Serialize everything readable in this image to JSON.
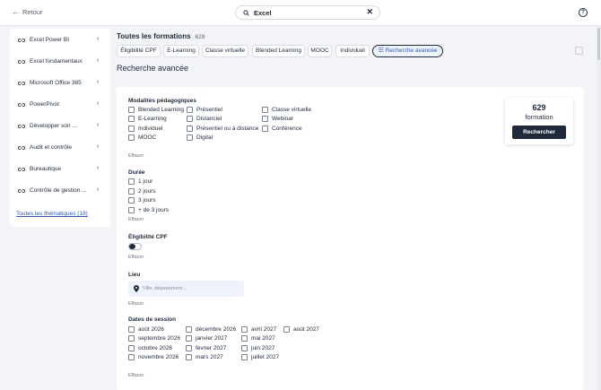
{
  "topbar": {
    "back_label": "Retour",
    "search_value": "Excel",
    "help_label": "?"
  },
  "sidebar": {
    "items": [
      {
        "label": "Excel Power BI"
      },
      {
        "label": "Excel fondamentaux"
      },
      {
        "label": "Microsoft Office 365"
      },
      {
        "label": "PowerPivot"
      },
      {
        "label": "Développer son ..."
      },
      {
        "label": "Audit et contrôle"
      },
      {
        "label": "Bureautique"
      },
      {
        "label": "Contrôle de gestion ..."
      }
    ],
    "all_link": "Toutes les thématiques (18)"
  },
  "header": {
    "title": "Toutes les formations",
    "count": "629"
  },
  "chips": [
    {
      "label": "Éligibilité CPF"
    },
    {
      "label": "E-Learning"
    },
    {
      "label": "Classe virtuelle"
    },
    {
      "label": "Blended Learning"
    },
    {
      "label": "MOOC"
    },
    {
      "label": "Individuel"
    },
    {
      "label": "Recherche avancée",
      "active": true
    }
  ],
  "advanced_title": "Recherche avancée",
  "filters": {
    "modalites": {
      "title": "Modalités pédagogiques",
      "options": [
        "Blended Learning",
        "Présentiel",
        "Classe virtuelle",
        "E-Learning",
        "Distanciel",
        "Webinar",
        "Individuel",
        "Présentiel ou à distance",
        "Conférence",
        "MOOC",
        "Digital"
      ],
      "clear": "Effacer"
    },
    "duree": {
      "title": "Durée",
      "options": [
        "1 jour",
        "2 jours",
        "3 jours",
        "+ de 3 jours"
      ],
      "clear": "Effacer"
    },
    "cpf": {
      "title": "Éligibilité CPF",
      "toggle_on": false,
      "clear": "Effacer"
    },
    "lieu": {
      "title": "Lieu",
      "placeholder": "Ville, département...",
      "clear": "Effacer"
    },
    "dates": {
      "title": "Dates de session",
      "options": [
        "août 2026",
        "septembre 2026",
        "octobre 2026",
        "novembre 2026",
        "décembre 2026",
        "janvier 2027",
        "février 2027",
        "mars 2027",
        "avril 2027",
        "mai 2027",
        "juin 2027",
        "juillet 2027",
        "août 2027"
      ],
      "clear": "Effacer"
    }
  },
  "results": {
    "count": "629",
    "label": "formation",
    "button": "Rechercher"
  },
  "colors": {
    "navy": "#1e2a3a",
    "link_blue": "#2e5aa8",
    "input_bg": "#eef2fb",
    "page_bg": "#f3f4f7"
  }
}
